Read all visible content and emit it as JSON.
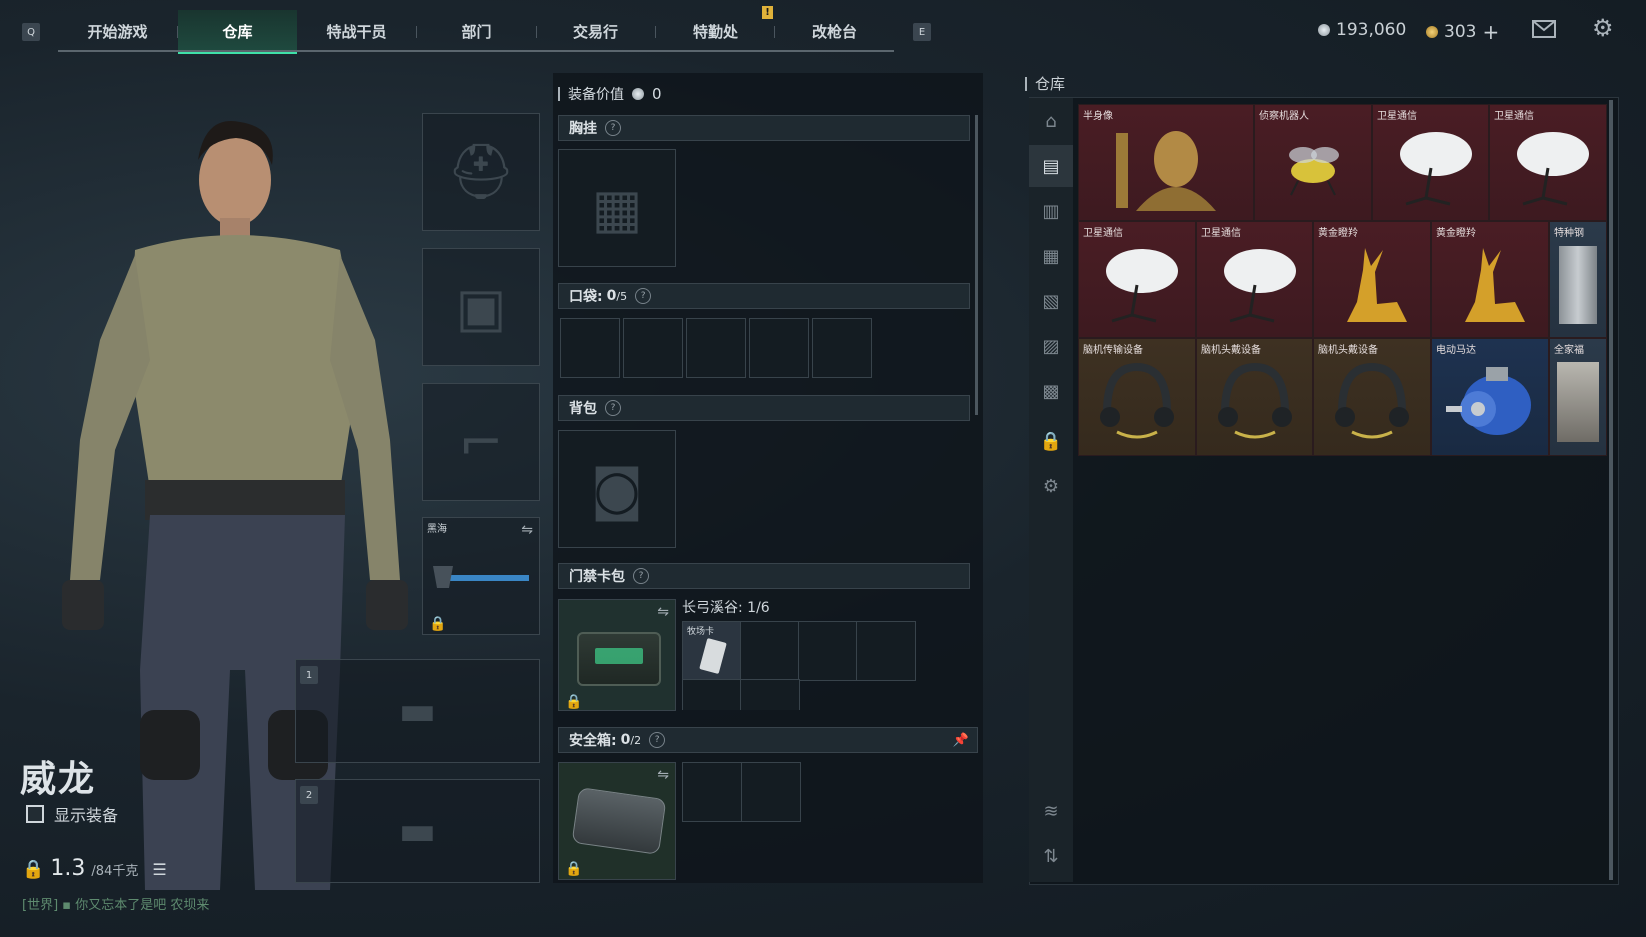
{
  "nav": {
    "left_key": "Q",
    "right_key": "E",
    "tabs": [
      {
        "label": "开始游戏"
      },
      {
        "label": "仓库"
      },
      {
        "label": "特战干员"
      },
      {
        "label": "部门"
      },
      {
        "label": "交易行"
      },
      {
        "label": "特勤处"
      },
      {
        "label": "改枪台"
      }
    ],
    "currency_a": "193,060",
    "currency_b": "303",
    "currency_b_add": "+",
    "alert_badge": "!"
  },
  "character": {
    "name": "威龙",
    "show_equipment_label": "显示装备",
    "weight_value": "1.3",
    "weight_capacity": "/84千克"
  },
  "chat": {
    "channel": "[世界]",
    "message": "你又忘本了是吧 农坝来"
  },
  "slots": {
    "melee_label": "黑海",
    "weapon1_number": "1",
    "weapon2_number": "2"
  },
  "equipment": {
    "value_label": "装备价值",
    "value": "0",
    "chest_rig": "胸挂",
    "pocket_label": "口袋:",
    "pocket_count": "0",
    "pocket_max": "/5",
    "backpack": "背包",
    "keycard_label": "门禁卡包",
    "keycard_area": "长弓溪谷: 1/6",
    "keycard_item": "牧场卡",
    "safe_label": "安全箱:",
    "safe_count": "0",
    "safe_max": "/2"
  },
  "warehouse": {
    "title": "仓库",
    "items": [
      {
        "label": "半身像",
        "color": "red"
      },
      {
        "label": "侦察机器人",
        "color": "red"
      },
      {
        "label": "卫星通信",
        "color": "red"
      },
      {
        "label": "卫星通信",
        "color": "red"
      },
      {
        "label": "卫星通信",
        "color": "red"
      },
      {
        "label": "卫星通信",
        "color": "red"
      },
      {
        "label": "黄金瞪羚",
        "color": "red"
      },
      {
        "label": "黄金瞪羚",
        "color": "red"
      },
      {
        "label": "特种钢",
        "color": "gray"
      },
      {
        "label": "脑机传输设备",
        "color": "brown"
      },
      {
        "label": "脑机头戴设备",
        "color": "brown"
      },
      {
        "label": "脑机头戴设备",
        "color": "brown"
      },
      {
        "label": "电动马达",
        "color": "blue"
      },
      {
        "label": "全家福",
        "color": "gray"
      }
    ]
  }
}
